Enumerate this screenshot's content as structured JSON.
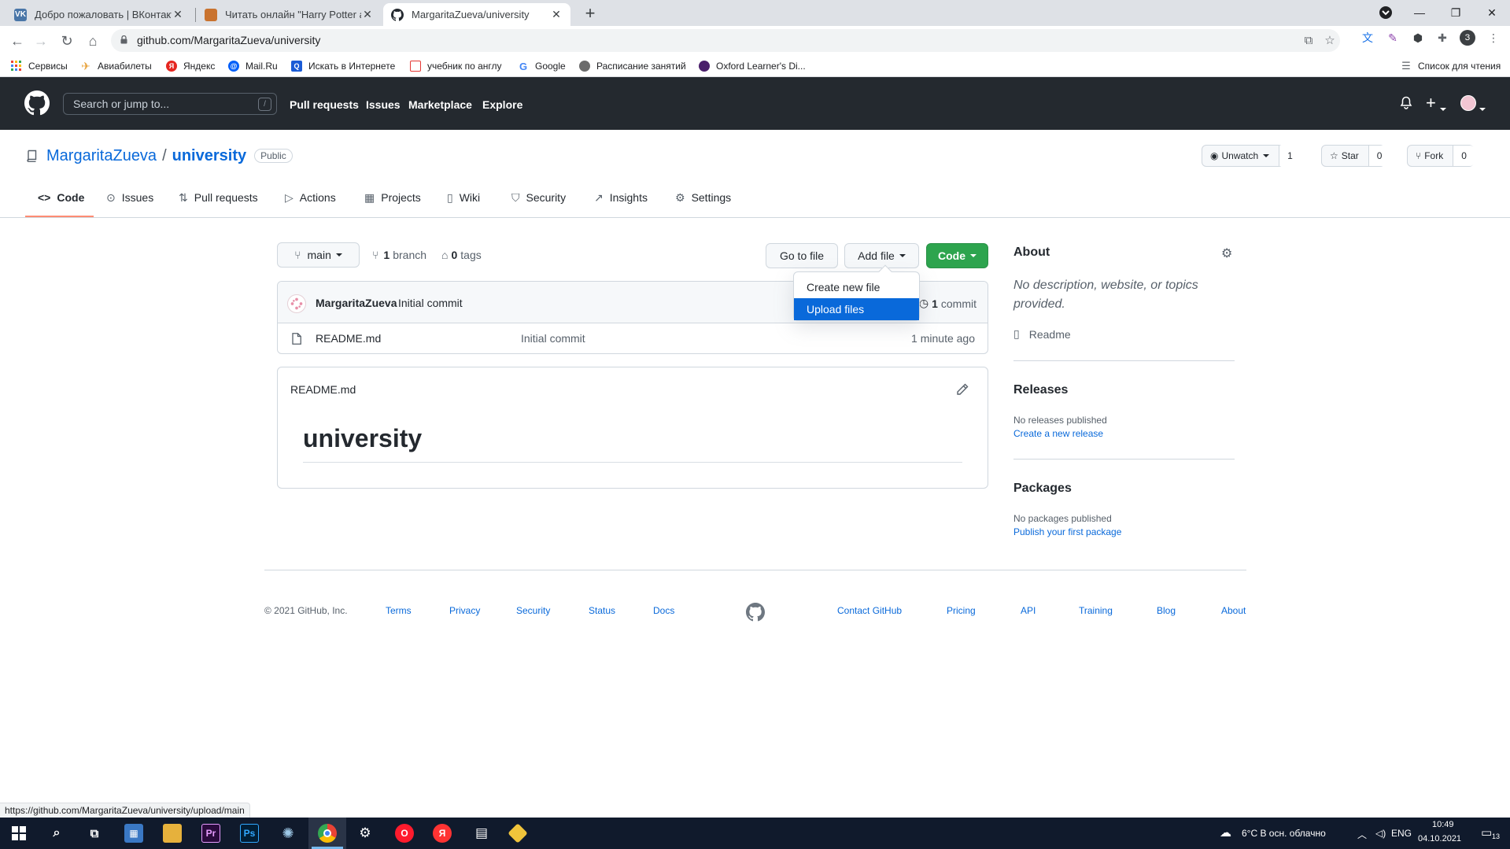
{
  "browser": {
    "tabs": [
      {
        "title": "Добро пожаловать | ВКонтакте",
        "icon": "vk-icon",
        "color": "#4a76a8"
      },
      {
        "title": "Читать онлайн \"Harry Potter and",
        "icon": "book-favicon",
        "color": "#c9732f"
      },
      {
        "title": "MargaritaZueva/university",
        "icon": "github-favicon",
        "color": "#24292f"
      }
    ],
    "url": "github.com/MargaritaZueva/university",
    "bookmarks": [
      "Сервисы",
      "Авиабилеты",
      "Яндекс",
      "Mail.Ru",
      "Искать в Интернете",
      "учебник по англу",
      "Google",
      "Расписание занятий",
      "Oxford Learner's Di..."
    ],
    "reading_list": "Список для чтения",
    "profile_letter": "З",
    "status_url": "https://github.com/MargaritaZueva/university/upload/main"
  },
  "github": {
    "search_placeholder": "Search or jump to...",
    "search_shortcut": "/",
    "nav": [
      "Pull requests",
      "Issues",
      "Marketplace",
      "Explore"
    ]
  },
  "repo": {
    "owner": "MargaritaZueva",
    "separator": "/",
    "name": "university",
    "visibility": "Public",
    "unwatch_label": "Unwatch",
    "unwatch_count": "1",
    "star_label": "Star",
    "star_count": "0",
    "fork_label": "Fork",
    "fork_count": "0",
    "tabs": [
      "Code",
      "Issues",
      "Pull requests",
      "Actions",
      "Projects",
      "Wiki",
      "Security",
      "Insights",
      "Settings"
    ]
  },
  "files": {
    "branch": "main",
    "branch_count": "1",
    "branch_word": "branch",
    "tag_count": "0",
    "tag_word": "tags",
    "go_to_file": "Go to file",
    "add_file": "Add file",
    "code": "Code",
    "dropdown": [
      "Create new file",
      "Upload files"
    ],
    "commit_author": "MargaritaZueva",
    "commit_message": "Initial commit",
    "commit_count": "1",
    "commit_word": "commit",
    "rows": [
      {
        "name": "README.md",
        "message": "Initial commit",
        "age": "1 minute ago"
      }
    ]
  },
  "readme": {
    "filename": "README.md",
    "heading": "university"
  },
  "sidebar": {
    "about_title": "About",
    "about_desc": "No description, website, or topics provided.",
    "readme_label": "Readme",
    "releases_title": "Releases",
    "releases_none": "No releases published",
    "releases_link": "Create a new release",
    "packages_title": "Packages",
    "packages_none": "No packages published",
    "packages_link": "Publish your first package"
  },
  "footer": {
    "copyright": "© 2021 GitHub, Inc.",
    "left_links": [
      "Terms",
      "Privacy",
      "Security",
      "Status",
      "Docs"
    ],
    "right_links": [
      "Contact GitHub",
      "Pricing",
      "API",
      "Training",
      "Blog",
      "About"
    ]
  },
  "taskbar": {
    "weather": "6°C  В осн. облачно",
    "lang": "ENG",
    "time": "10:49",
    "date": "04.10.2021",
    "notifications": "13"
  }
}
